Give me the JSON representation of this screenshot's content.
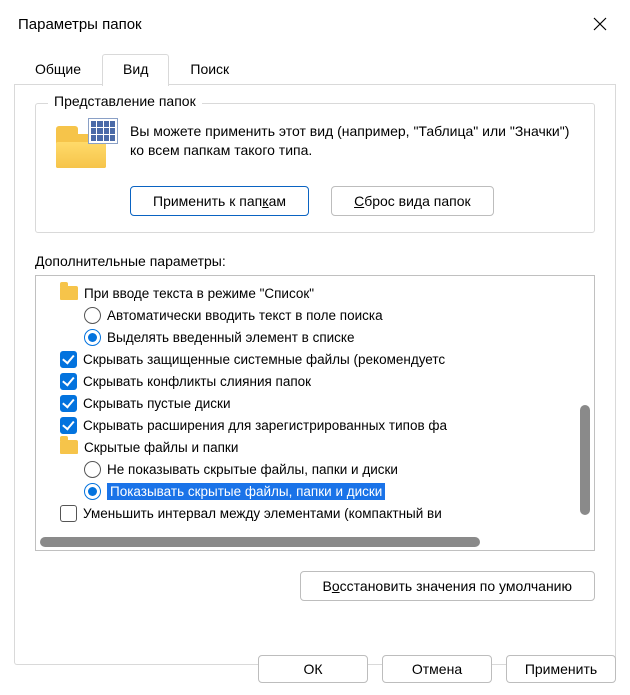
{
  "title": "Параметры папок",
  "tabs": {
    "general": "Общие",
    "view": "Вид",
    "search": "Поиск"
  },
  "folder_views": {
    "legend": "Представление папок",
    "desc": "Вы можете применить этот вид (например, \"Таблица\" или \"Значки\") ко всем папкам такого типа.",
    "apply_btn_pre": "Применить к пап",
    "apply_btn_u": "к",
    "apply_btn_post": "ам",
    "reset_btn_u": "С",
    "reset_btn_post": "брос вида папок"
  },
  "adv_label": "Дополнительные параметры:",
  "tree": {
    "n0": "При вводе текста в режиме \"Список\"",
    "n0_opt0": "Автоматически вводить текст в поле поиска",
    "n0_opt1": "Выделять введенный элемент в списке",
    "n1": "Скрывать защищенные системные файлы (рекомендуетс",
    "n2": "Скрывать конфликты слияния папок",
    "n3": "Скрывать пустые диски",
    "n4": "Скрывать расширения для зарегистрированных типов фа",
    "n5": "Скрытые файлы и папки",
    "n5_opt0": "Не показывать скрытые файлы, папки и диски",
    "n5_opt1": "Показывать скрытые файлы, папки и диски",
    "n6": "Уменьшить интервал между элементами (компактный ви"
  },
  "restore_pre": "В",
  "restore_u": "о",
  "restore_post": "сстановить значения по умолчанию",
  "buttons": {
    "ok": "ОК",
    "cancel": "Отмена",
    "apply": "Применить"
  }
}
